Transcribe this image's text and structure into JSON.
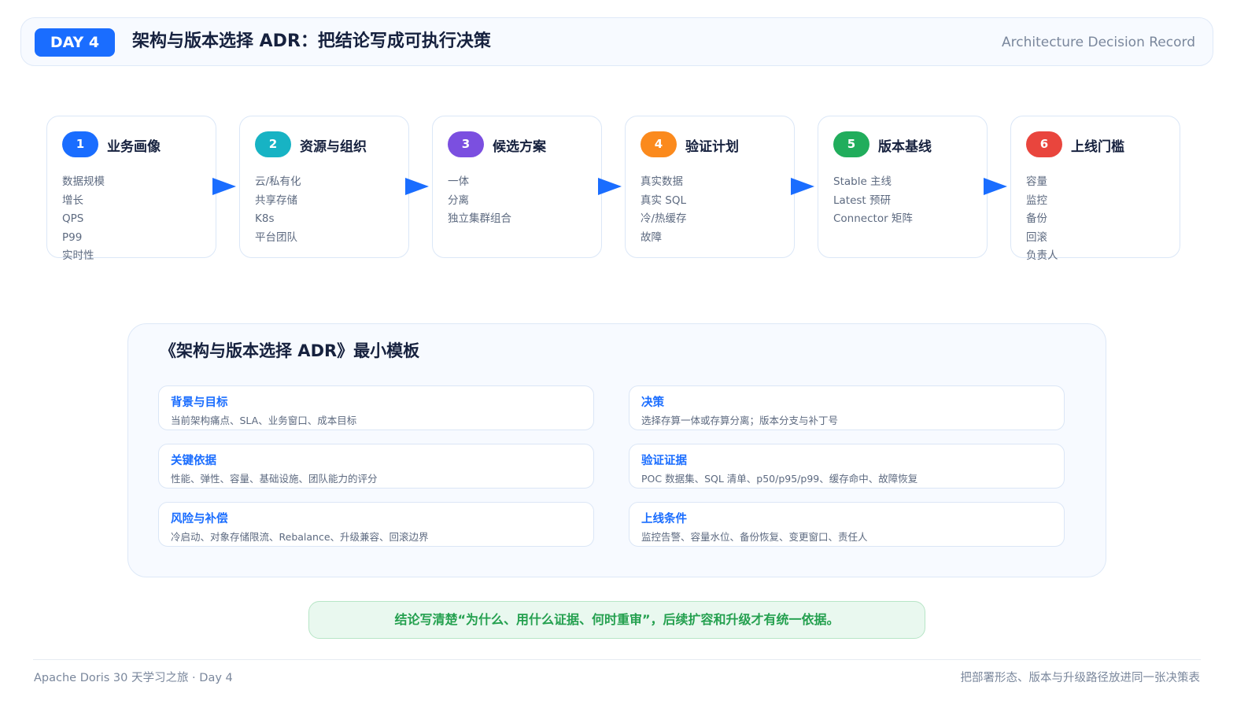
{
  "header": {
    "badge": "DAY 4",
    "title": "架构与版本选择 ADR：把结论写成可执行决策",
    "subtitle": "Architecture Decision Record"
  },
  "steps": [
    {
      "num": "1",
      "title": "业务画像",
      "color": "#1a6dff",
      "items": [
        "数据规模",
        "增长",
        "QPS",
        "P99",
        "实时性"
      ]
    },
    {
      "num": "2",
      "title": "资源与组织",
      "color": "#17b3c4",
      "items": [
        "云/私有化",
        "共享存储",
        "K8s",
        "平台团队"
      ]
    },
    {
      "num": "3",
      "title": "候选方案",
      "color": "#7b4fe0",
      "items": [
        "一体",
        "分离",
        "独立集群组合"
      ]
    },
    {
      "num": "4",
      "title": "验证计划",
      "color": "#fb8a1d",
      "items": [
        "真实数据",
        "真实 SQL",
        "冷/热缓存",
        "故障"
      ]
    },
    {
      "num": "5",
      "title": "版本基线",
      "color": "#21ad5c",
      "items": [
        "Stable 主线",
        "Latest 预研",
        "Connector 矩阵"
      ]
    },
    {
      "num": "6",
      "title": "上线门槛",
      "color": "#e9453d",
      "items": [
        "容量",
        "监控",
        "备份",
        "回滚",
        "负责人"
      ]
    }
  ],
  "template": {
    "title": "《架构与版本选择 ADR》最小模板",
    "cards": [
      {
        "title": "背景与目标",
        "desc": "当前架构痛点、SLA、业务窗口、成本目标"
      },
      {
        "title": "决策",
        "desc": "选择存算一体或存算分离；版本分支与补丁号"
      },
      {
        "title": "关键依据",
        "desc": "性能、弹性、容量、基础设施、团队能力的评分"
      },
      {
        "title": "验证证据",
        "desc": "POC 数据集、SQL 清单、p50/p95/p99、缓存命中、故障恢复"
      },
      {
        "title": "风险与补偿",
        "desc": "冷启动、对象存储限流、Rebalance、升级兼容、回滚边界"
      },
      {
        "title": "上线条件",
        "desc": "监控告警、容量水位、备份恢复、变更窗口、责任人"
      }
    ]
  },
  "conclusion": "结论写清楚“为什么、用什么证据、何时重审”，后续扩容和升级才有统一依据。",
  "footer": {
    "left": "Apache Doris 30 天学习之旅 · Day 4",
    "right": "把部署形态、版本与升级路径放进同一张决策表"
  }
}
